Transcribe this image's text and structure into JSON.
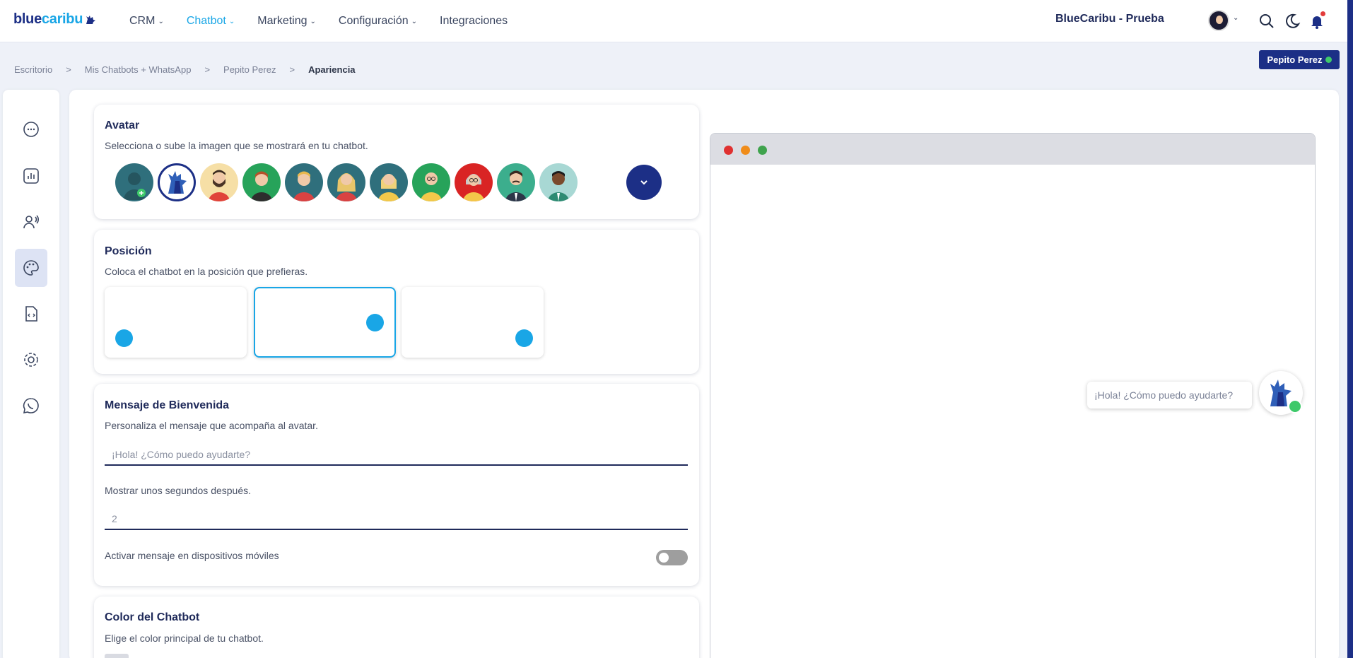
{
  "logo": {
    "part1": "blue",
    "part2": "caribu"
  },
  "nav": {
    "items": [
      {
        "label": "CRM",
        "active": false,
        "dropdown": true
      },
      {
        "label": "Chatbot",
        "active": true,
        "dropdown": true
      },
      {
        "label": "Marketing",
        "active": false,
        "dropdown": true
      },
      {
        "label": "Configuración",
        "active": false,
        "dropdown": true
      },
      {
        "label": "Integraciones",
        "active": false,
        "dropdown": false
      }
    ],
    "company": "BlueCaribu - Prueba"
  },
  "breadcrumb": [
    "Escritorio",
    "Mis Chatbots + WhatsApp",
    "Pepito Perez",
    "Apariencia"
  ],
  "breadcrumb_sep": ">",
  "chatbot_badge": "Pepito Perez",
  "sidebar_icons": [
    "chat-icon",
    "chart-icon",
    "voice-user-icon",
    "palette-icon",
    "code-file-icon",
    "gear-icon",
    "whatsapp-icon"
  ],
  "avatar_card": {
    "title": "Avatar",
    "subtitle": "Selecciona o sube la imagen que se mostrará en tu chatbot."
  },
  "position_card": {
    "title": "Posición",
    "subtitle": "Coloca el chatbot en la posición que prefieras."
  },
  "welcome_card": {
    "title": "Mensaje de Bienvenida",
    "subtitle": "Personaliza el mensaje que acompaña al avatar.",
    "message_placeholder": "¡Hola! ¿Cómo puedo ayudarte?",
    "delay_label": "Mostrar unos segundos después.",
    "delay_value": "2",
    "mobile_label": "Activar mensaje en dispositivos móviles",
    "mobile_enabled": false
  },
  "color_card": {
    "title": "Color del Chatbot",
    "subtitle": "Elige el color principal de tu chatbot."
  },
  "preview": {
    "bubble_text": "¡Hola! ¿Cómo puedo ayudarte?"
  },
  "colors": {
    "brand": "#1c2f86",
    "accent": "#19a6e6",
    "online": "#3ec96a"
  }
}
